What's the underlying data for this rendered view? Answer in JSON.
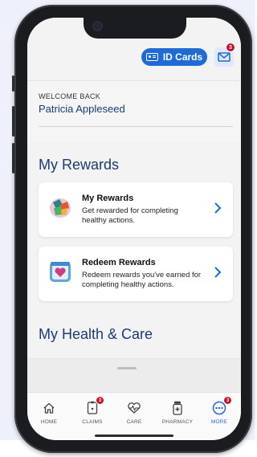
{
  "header": {
    "id_cards_label": "ID Cards",
    "mail_badge": "3"
  },
  "welcome": {
    "label": "WELCOME BACK",
    "name": "Patricia Appleseed"
  },
  "rewards_section": {
    "title": "My Rewards",
    "cards": [
      {
        "title": "My Rewards",
        "description": "Get rewarded for completing healthy actions."
      },
      {
        "title": "Redeem Rewards",
        "description": "Redeem rewards you've earned for completing healthy actions."
      }
    ]
  },
  "health_section": {
    "title": "My Health & Care"
  },
  "tabbar": {
    "tabs": [
      {
        "label": "HOME",
        "icon": "home-icon"
      },
      {
        "label": "CLAIMS",
        "icon": "claims-icon",
        "badge": "3"
      },
      {
        "label": "CARE",
        "icon": "heart-pulse-icon"
      },
      {
        "label": "PHARMACY",
        "icon": "pill-bottle-icon"
      },
      {
        "label": "MORE",
        "icon": "more-icon",
        "badge": "3"
      }
    ]
  },
  "colors": {
    "primary": "#1e6ad9",
    "heading": "#1d3b72",
    "badge": "#c8102e"
  }
}
